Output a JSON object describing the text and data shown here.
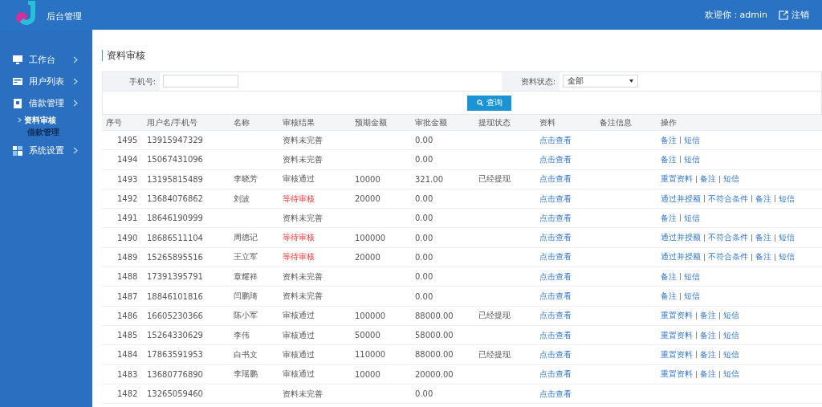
{
  "header": {
    "brand": "后台管理",
    "welcome": "欢迎你：admin",
    "logout": "注销"
  },
  "sidebar": {
    "items": [
      {
        "label": "工作台",
        "expanded": false
      },
      {
        "label": "用户列表",
        "expanded": false
      },
      {
        "label": "借款管理",
        "expanded": true,
        "children": [
          {
            "label": "资料审核",
            "selected": true
          },
          {
            "label": "借款管理",
            "selected": false
          }
        ]
      },
      {
        "label": "系统设置",
        "expanded": false
      }
    ]
  },
  "page_title": "资料审核",
  "filters": {
    "phone_label": "手机号:",
    "status_label": "资料状态:",
    "status_value": "全部",
    "search_button": "查询"
  },
  "table": {
    "columns": [
      "序号",
      "用户名/手机号",
      "名称",
      "审核结果",
      "预期金额",
      "审批金额",
      "提现状态",
      "资料",
      "备注信息",
      "操作"
    ],
    "rows": [
      {
        "id": "1495",
        "phone": "13915947329",
        "name": "",
        "result": "资料未完善",
        "pending": false,
        "expected": "",
        "approved": "0.00",
        "withdraw": "",
        "docs": "点击查看",
        "actions": [
          "备注",
          "短信"
        ]
      },
      {
        "id": "1494",
        "phone": "15067431096",
        "name": "",
        "result": "资料未完善",
        "pending": false,
        "expected": "",
        "approved": "0.00",
        "withdraw": "",
        "docs": "点击查看",
        "actions": [
          "备注",
          "短信"
        ]
      },
      {
        "id": "1493",
        "phone": "13195815489",
        "name": "李晓芳",
        "result": "审核通过",
        "pending": false,
        "expected": "10000",
        "approved": "321.00",
        "withdraw": "已经提现",
        "docs": "点击查看",
        "actions": [
          "重置资料",
          "备注",
          "短信"
        ]
      },
      {
        "id": "1492",
        "phone": "13684076862",
        "name": "刘波",
        "result": "等待审核",
        "pending": true,
        "expected": "20000",
        "approved": "0.00",
        "withdraw": "",
        "docs": "点击查看",
        "actions": [
          "通过并授额",
          "不符合条件",
          "备注",
          "短信"
        ]
      },
      {
        "id": "1491",
        "phone": "18646190999",
        "name": "",
        "result": "资料未完善",
        "pending": false,
        "expected": "",
        "approved": "0.00",
        "withdraw": "",
        "docs": "点击查看",
        "actions": [
          "备注",
          "短信"
        ]
      },
      {
        "id": "1490",
        "phone": "18686511104",
        "name": "周德记",
        "result": "等待审核",
        "pending": true,
        "expected": "100000",
        "approved": "0.00",
        "withdraw": "",
        "docs": "点击查看",
        "actions": [
          "通过并授额",
          "不符合条件",
          "备注",
          "短信"
        ]
      },
      {
        "id": "1489",
        "phone": "15265895516",
        "name": "王立军",
        "result": "等待审核",
        "pending": true,
        "expected": "20000",
        "approved": "0.00",
        "withdraw": "",
        "docs": "点击查看",
        "actions": [
          "通过并授额",
          "不符合条件",
          "备注",
          "短信"
        ]
      },
      {
        "id": "1488",
        "phone": "17391395791",
        "name": "章耀祥",
        "result": "资料未完善",
        "pending": false,
        "expected": "",
        "approved": "0.00",
        "withdraw": "",
        "docs": "点击查看",
        "actions": [
          "备注",
          "短信"
        ]
      },
      {
        "id": "1487",
        "phone": "18846101816",
        "name": "闫鹏琦",
        "result": "资料未完善",
        "pending": false,
        "expected": "",
        "approved": "0.00",
        "withdraw": "",
        "docs": "点击查看",
        "actions": [
          "备注",
          "短信"
        ]
      },
      {
        "id": "1486",
        "phone": "16605230366",
        "name": "陈小军",
        "result": "审核通过",
        "pending": false,
        "expected": "100000",
        "approved": "88000.00",
        "withdraw": "已经提现",
        "docs": "点击查看",
        "actions": [
          "重置资料",
          "备注",
          "短信"
        ]
      },
      {
        "id": "1485",
        "phone": "15264330629",
        "name": "李伟",
        "result": "审核通过",
        "pending": false,
        "expected": "50000",
        "approved": "58000.00",
        "withdraw": "",
        "docs": "点击查看",
        "actions": [
          "重置资料",
          "备注",
          "短信"
        ]
      },
      {
        "id": "1484",
        "phone": "17863591953",
        "name": "白书文",
        "result": "审核通过",
        "pending": false,
        "expected": "110000",
        "approved": "88000.00",
        "withdraw": "已经提现",
        "docs": "点击查看",
        "actions": [
          "重置资料",
          "备注",
          "短信"
        ]
      },
      {
        "id": "1483",
        "phone": "13680776890",
        "name": "李瑶鹏",
        "result": "审核通过",
        "pending": false,
        "expected": "10000",
        "approved": "20000.00",
        "withdraw": "",
        "docs": "点击查看",
        "actions": [
          "重置资料",
          "备注",
          "短信"
        ]
      },
      {
        "id": "1482",
        "phone": "13265059460",
        "name": "",
        "result": "资料未完善",
        "pending": false,
        "expected": "",
        "approved": "0.00",
        "withdraw": "",
        "docs": "点击查看",
        "actions": []
      }
    ]
  }
}
